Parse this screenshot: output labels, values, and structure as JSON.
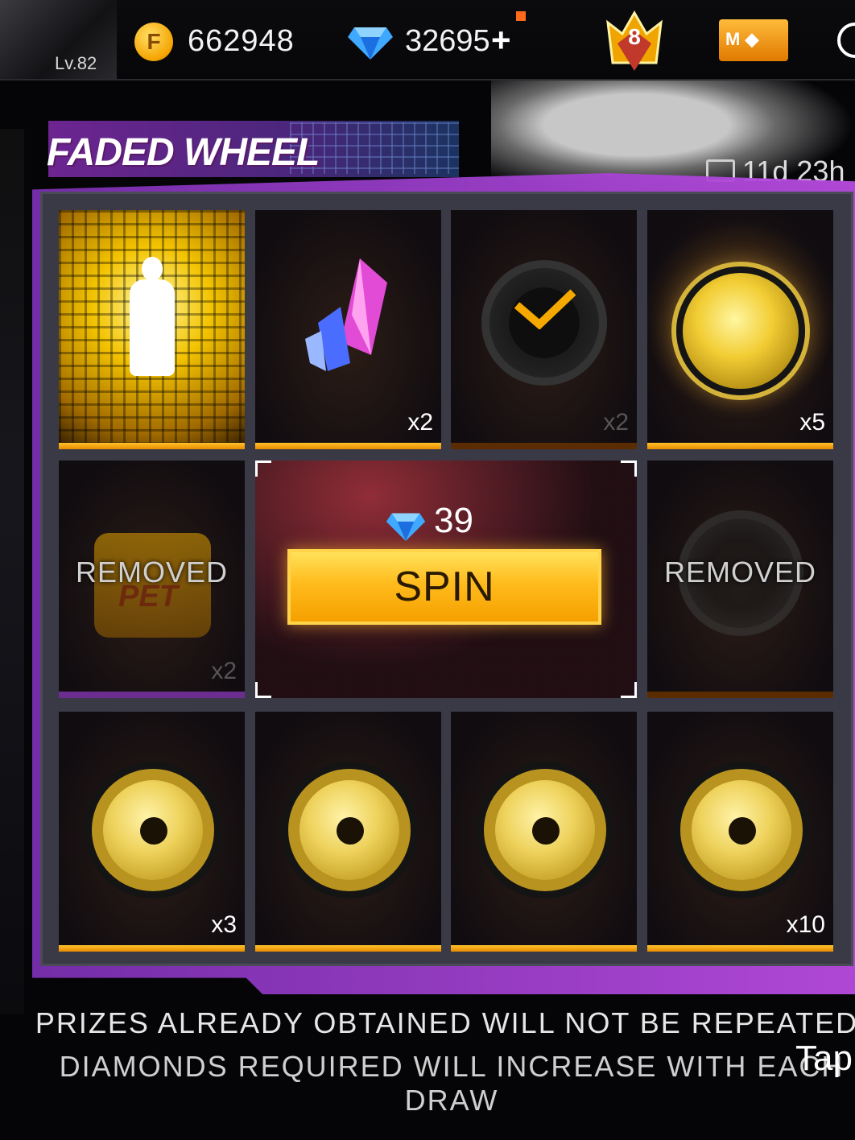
{
  "header": {
    "level": "Lv.82",
    "gold_icon_letter": "F",
    "gold": "662948",
    "diamonds": "32695",
    "plus": "+",
    "rank": "8",
    "membership_letter": "M"
  },
  "page": {
    "title": "FADED WHEEL",
    "timer": "11d 23h"
  },
  "grid": {
    "items": [
      {
        "name": "emote",
        "qty": ""
      },
      {
        "name": "crystal",
        "qty": "x2"
      },
      {
        "name": "check-token",
        "qty": "x2"
      },
      {
        "name": "gold-token",
        "qty": "x5"
      },
      {
        "name": "pet-food",
        "qty": "x2",
        "status": "REMOVED",
        "pet_label": "PET"
      },
      {
        "name": "dark-token",
        "qty": "",
        "status": "REMOVED"
      },
      {
        "name": "swirl-token",
        "qty": "x3"
      },
      {
        "name": "swirl-token",
        "qty": ""
      },
      {
        "name": "swirl-token",
        "qty": ""
      },
      {
        "name": "swirl-token",
        "qty": "x10"
      }
    ]
  },
  "spin": {
    "cost": "39",
    "label": "SPIN"
  },
  "notice": {
    "line1": "PRIZES ALREADY OBTAINED WILL NOT BE REPEATED.",
    "line2": "DIAMONDS REQUIRED WILL INCREASE WITH EACH DRAW",
    "tap": "Tap"
  },
  "colors": {
    "accent_gold": "#ffbb1c",
    "panel_purple": "#b84be0",
    "diamond_blue": "#3fa8ff"
  }
}
